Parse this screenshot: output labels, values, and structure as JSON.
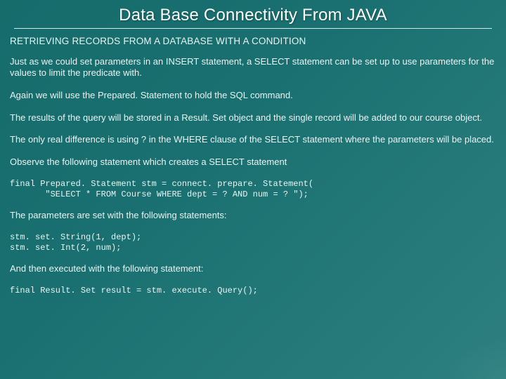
{
  "title": "Data Base Connectivity From JAVA",
  "subheading": "RETRIEVING RECORDS FROM A DATABASE WITH A CONDITION",
  "paragraphs": {
    "p1": "Just as we could set parameters in an INSERT statement, a SELECT statement can be set up to use parameters for the values to limit the predicate with.",
    "p2": "Again we will use the Prepared. Statement to hold the SQL command.",
    "p3": "The results of the query will be stored in a Result. Set object and the single record will be added to our course object.",
    "p4": "The only real difference is using ? in the WHERE clause of the SELECT statement where the parameters will be placed.",
    "p5": "Observe the following statement which creates a SELECT statement",
    "p6": "The parameters are set with the following statements:",
    "p7": "And then executed with the following statement:"
  },
  "code": {
    "c1": "final Prepared. Statement stm = connect. prepare. Statement(\n       \"SELECT * FROM Course WHERE dept = ? AND num = ? \");",
    "c2": "stm. set. String(1, dept);\nstm. set. Int(2, num);",
    "c3": "final Result. Set result = stm. execute. Query();"
  }
}
